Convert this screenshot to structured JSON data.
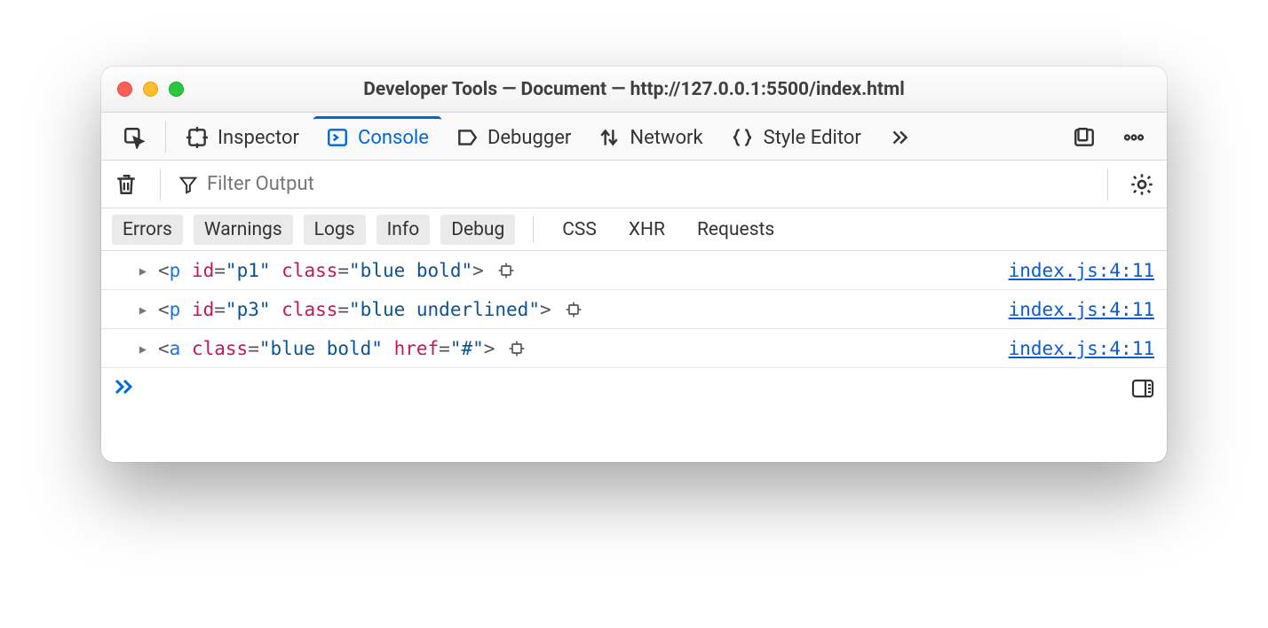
{
  "window": {
    "title": "Developer Tools — Document — http://127.0.0.1:5500/index.html"
  },
  "tabs": {
    "inspector": "Inspector",
    "console": "Console",
    "debugger": "Debugger",
    "network": "Network",
    "style_editor": "Style Editor"
  },
  "filter": {
    "placeholder": "Filter Output"
  },
  "categories": {
    "errors": "Errors",
    "warnings": "Warnings",
    "logs": "Logs",
    "info": "Info",
    "debug": "Debug",
    "css": "CSS",
    "xhr": "XHR",
    "requests": "Requests"
  },
  "rows": [
    {
      "tag": "p",
      "attrs": [
        {
          "name": "id",
          "value": "p1"
        },
        {
          "name": "class",
          "value": "blue bold"
        }
      ],
      "location": "index.js:4:11"
    },
    {
      "tag": "p",
      "attrs": [
        {
          "name": "id",
          "value": "p3"
        },
        {
          "name": "class",
          "value": "blue underlined"
        }
      ],
      "location": "index.js:4:11"
    },
    {
      "tag": "a",
      "attrs": [
        {
          "name": "class",
          "value": "blue bold"
        },
        {
          "name": "href",
          "value": "#"
        }
      ],
      "location": "index.js:4:11"
    }
  ],
  "prompt": "≫"
}
